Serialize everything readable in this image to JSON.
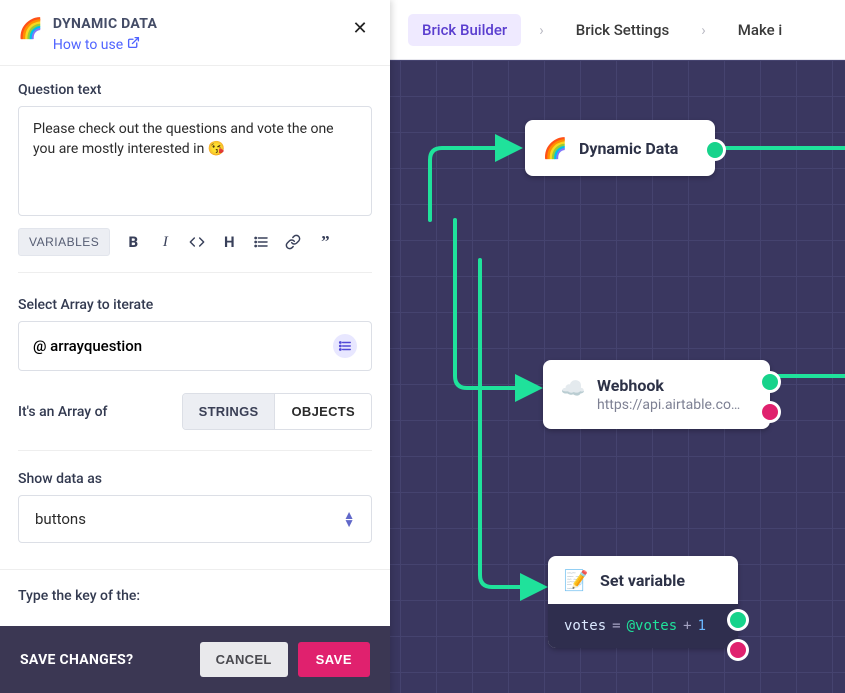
{
  "panel": {
    "title": "DYNAMIC DATA",
    "how_to_use": "How to use",
    "question_text_label": "Question text",
    "question_text_value": "Please check out the questions and vote the one you are mostly interested in 😘",
    "variables_button": "VARIABLES",
    "select_array_label": "Select Array to iterate",
    "select_array_value": "@ arrayquestion",
    "array_of_label": "It's an Array of",
    "seg_strings": "STRINGS",
    "seg_objects": "OBJECTS",
    "seg_active": "strings",
    "show_as_label": "Show data as",
    "show_as_value": "buttons",
    "type_key_label": "Type the key of the:"
  },
  "savebar": {
    "question": "SAVE CHANGES?",
    "cancel": "CANCEL",
    "save": "SAVE"
  },
  "breadcrumb": {
    "items": [
      {
        "label": "Brick Builder",
        "active": true
      },
      {
        "label": "Brick Settings",
        "active": false
      },
      {
        "label": "Make i",
        "active": false
      }
    ]
  },
  "nodes": {
    "dynamic": {
      "title": "Dynamic Data",
      "icon": "🌈"
    },
    "webhook": {
      "title": "Webhook",
      "subtitle": "https://api.airtable.co…",
      "icon": "☁️"
    },
    "setvar": {
      "title": "Set variable",
      "icon": "📝",
      "expr": {
        "var": "votes",
        "eq": "=",
        "at": "@votes",
        "plus": "+",
        "num": "1"
      }
    }
  }
}
